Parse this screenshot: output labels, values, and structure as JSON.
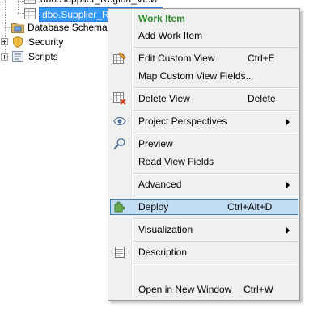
{
  "tree": {
    "items": [
      {
        "label": "dbo.Supplier_Region_View"
      },
      {
        "label": "dbo.Supplier_Region_View"
      },
      {
        "label": "Database Schemas"
      },
      {
        "label": "Security"
      },
      {
        "label": "Scripts"
      }
    ]
  },
  "menu": {
    "header": "Work Item",
    "add_work_item": "Add Work Item",
    "edit_custom_view": {
      "label": "Edit Custom View",
      "shortcut": "Ctrl+E"
    },
    "map_custom_view_fields": "Map Custom View Fields...",
    "delete_view": {
      "label": "Delete View",
      "shortcut": "Delete"
    },
    "project_perspectives": "Project Perspectives",
    "preview": "Preview",
    "read_view_fields": "Read View Fields",
    "advanced": "Advanced",
    "deploy": {
      "label": "Deploy",
      "shortcut": "Ctrl+Alt+D"
    },
    "visualization": "Visualization",
    "description": "Description",
    "open_in_new_window": {
      "label": "Open in New Window",
      "shortcut": "Ctrl+W"
    }
  },
  "colors": {
    "accent_green": "#2b8a2b",
    "selection_blue": "#3399ff",
    "menu_highlight": "#c2dcf3"
  }
}
